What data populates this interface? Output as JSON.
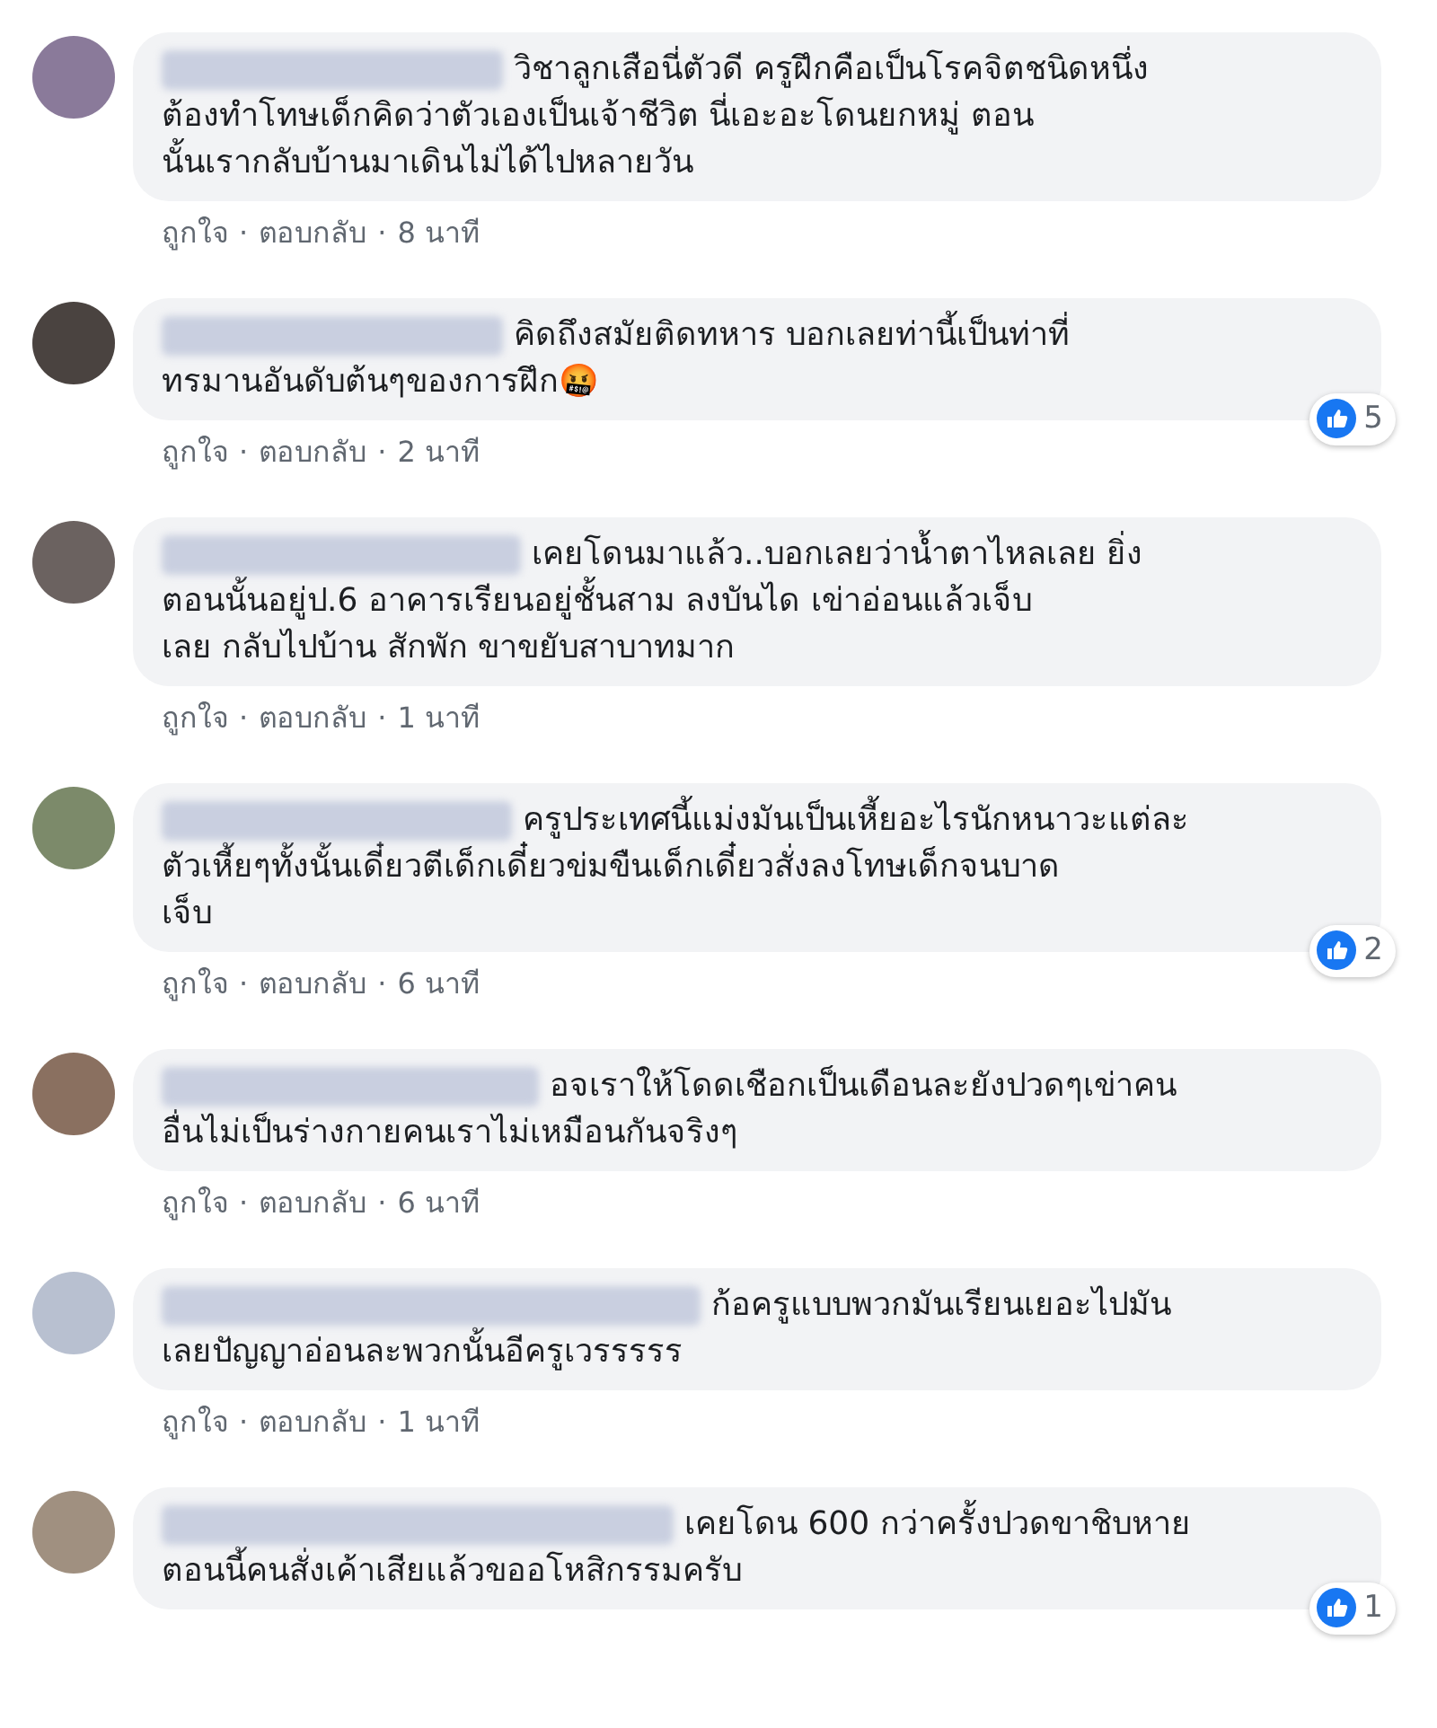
{
  "separator": "·",
  "comments": [
    {
      "text": "วิชาลูกเสือนี่ตัวดี ครูฝึกคือเป็นโรคจิตชนิดหนึ่ง\nต้องทำโทษเด็กคิดว่าตัวเองเป็นเจ้าชีวิต นี่เอะอะโดนยกหมู่ ตอน\nนั้นเรากลับบ้านมาเดินไม่ได้ไปหลายวัน",
      "actions": [
        "ถูกใจ",
        "ตอบกลับ"
      ],
      "time": "8 นาที"
    },
    {
      "text": "คิดถึงสมัยติดทหาร บอกเลยท่านี้เป็นท่าที่\nทรมานอันดับต้นๆของการฝึก🤬",
      "actions": [
        "ถูกใจ",
        "ตอบกลับ"
      ],
      "time": "2 นาที",
      "reactions": "5"
    },
    {
      "text": "เคยโดนมาแล้ว..บอกเลยว่าน้ำตาไหลเลย ยิ่ง\nตอนนั้นอยู่ป.6 อาคารเรียนอยู่ชั้นสาม ลงบันได เข่าอ่อนแล้วเจ็บ\nเลย กลับไปบ้าน สักพัก ขาขยับสาบาทมาก",
      "actions": [
        "ถูกใจ",
        "ตอบกลับ"
      ],
      "time": "1 นาที"
    },
    {
      "text": "ครูประเทศนี้แม่งมันเป็นเหี้ยอะไรนักหนาวะแต่ละ\nตัวเหี้ยๆทั้งนั้นเดี๋ยวตีเด็กเดี๋ยวข่มขืนเด็กเดี๋ยวสั่งลงโทษเด็กจนบาด\nเจ็บ",
      "actions": [
        "ถูกใจ",
        "ตอบกลับ"
      ],
      "time": "6 นาที",
      "reactions": "2"
    },
    {
      "text": "อจเราให้โดดเชือกเป็นเดือนละยังปวดๆเข่าคน\nอื่นไม่เป็นร่างกายคนเราไม่เหมือนกันจริงๆ",
      "actions": [
        "ถูกใจ",
        "ตอบกลับ"
      ],
      "time": "6 นาที"
    },
    {
      "text": "ก้อครูแบบพวกมันเรียนเยอะไปมัน\nเลยปัญญาอ่อนละพวกนั้นอีครูเวรรรรร",
      "actions": [
        "ถูกใจ",
        "ตอบกลับ"
      ],
      "time": "1 นาที"
    },
    {
      "text": "เคยโดน 600 กว่าครั้งปวดขาชิบหาย\nตอนนี้คนสั่งเค้าเสียแล้วขออโหสิกรรมครับ",
      "reactions": "1"
    }
  ]
}
